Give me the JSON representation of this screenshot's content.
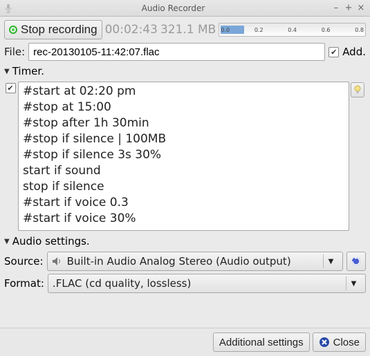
{
  "window": {
    "title": "Audio Recorder"
  },
  "toolbar": {
    "record_label": "Stop recording",
    "elapsed": "00:02:43",
    "filesize": "321.1 MB",
    "level_ticks": [
      "0.0",
      "0.2",
      "0.4",
      "0.6",
      "0.8"
    ]
  },
  "file": {
    "label": "File:",
    "value": "rec-20130105-11:42:07.flac",
    "add_label": "Add."
  },
  "timer": {
    "header": "Timer.",
    "lines": [
      "#start at 02:20 pm",
      "#stop at 15:00",
      "#stop after 1h 30min",
      "#stop if silence | 100MB",
      "#stop if silence 3s 30%",
      "start if sound",
      "stop if silence",
      "#start if voice 0.3",
      "#start if voice 30%"
    ]
  },
  "audio": {
    "header": "Audio settings.",
    "source_label": "Source:",
    "source_value": "Built-in Audio Analog Stereo (Audio output)",
    "format_label": "Format:",
    "format_value": ".FLAC  (cd quality, lossless)"
  },
  "bottom": {
    "additional": "Additional settings",
    "close": "Close"
  }
}
